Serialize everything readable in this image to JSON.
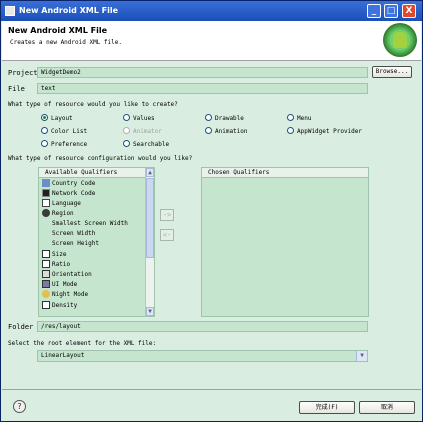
{
  "window": {
    "title": "New Android XML File",
    "minimize": "_",
    "maximize": "□",
    "close": "X"
  },
  "header": {
    "title": "New Android XML File",
    "subtitle": "Creates a new Android XML file."
  },
  "form": {
    "project_label": "Project",
    "project_value": "WidgetDemo2",
    "browse_label": "Browse...",
    "file_label": "File",
    "file_value": "text",
    "resource_question": "What type of resource would you like to create?",
    "config_question": "What type of resource configuration would you like?",
    "folder_label": "Folder",
    "folder_value": "/res/layout",
    "root_question": "Select the root element for the XML file:",
    "root_value": "LinearLayout"
  },
  "resource_types": [
    {
      "label": "Layout",
      "checked": true,
      "disabled": false
    },
    {
      "label": "Values",
      "checked": false,
      "disabled": false
    },
    {
      "label": "Drawable",
      "checked": false,
      "disabled": false
    },
    {
      "label": "Menu",
      "checked": false,
      "disabled": false
    },
    {
      "label": "Color List",
      "checked": false,
      "disabled": false
    },
    {
      "label": "Animator",
      "checked": false,
      "disabled": true
    },
    {
      "label": "Animation",
      "checked": false,
      "disabled": false
    },
    {
      "label": "AppWidget Provider",
      "checked": false,
      "disabled": false
    },
    {
      "label": "Preference",
      "checked": false,
      "disabled": false
    },
    {
      "label": "Searchable",
      "checked": false,
      "disabled": false
    }
  ],
  "qualifiers": {
    "available_header": "Available Qualifiers",
    "chosen_header": "Chosen Qualifiers",
    "items": [
      {
        "label": "Country Code",
        "icon": "country-code-icon"
      },
      {
        "label": "Network Code",
        "icon": "network-code-icon"
      },
      {
        "label": "Language",
        "icon": "language-icon"
      },
      {
        "label": "Region",
        "icon": "region-icon"
      },
      {
        "label": "Smallest Screen Width",
        "icon": ""
      },
      {
        "label": "Screen Width",
        "icon": ""
      },
      {
        "label": "Screen Height",
        "icon": ""
      },
      {
        "label": "Size",
        "icon": "size-icon"
      },
      {
        "label": "Ratio",
        "icon": "ratio-icon"
      },
      {
        "label": "Orientation",
        "icon": "orientation-icon"
      },
      {
        "label": "UI Mode",
        "icon": "ui-mode-icon"
      },
      {
        "label": "Night Mode",
        "icon": "night-mode-icon"
      },
      {
        "label": "Density",
        "icon": "density-icon"
      }
    ],
    "add_arrow": "->",
    "remove_arrow": "<-"
  },
  "buttons": {
    "finish": "完成(F)",
    "cancel": "取消",
    "help": "?"
  },
  "colors": {
    "dialog_bg": "#d9eee0",
    "field_bg": "#c6e5cf",
    "titlebar": "#1a4fb8"
  }
}
